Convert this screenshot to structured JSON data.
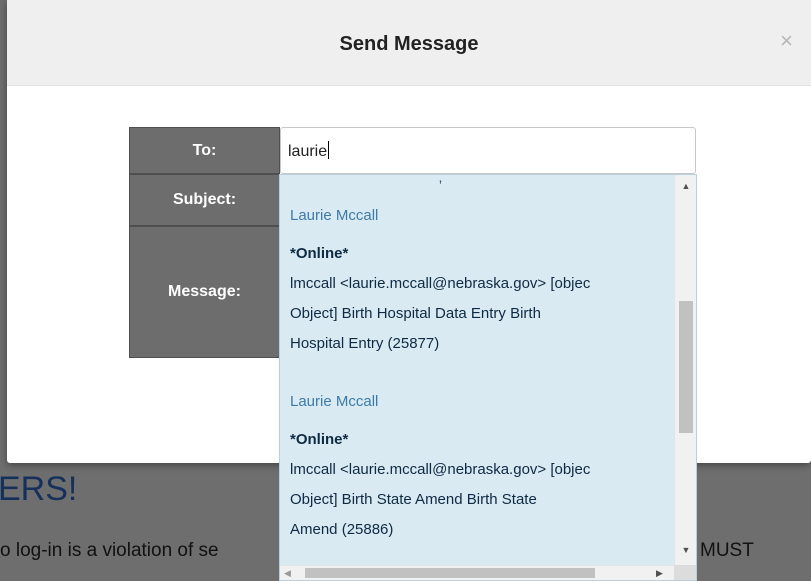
{
  "background": {
    "heading_fragment": "ERS!",
    "text_left_fragment": "o log-in is a violation of se",
    "text_right_fragment": "MUST"
  },
  "modal": {
    "title": "Send Message",
    "close_label": "×"
  },
  "form": {
    "to_label": "To:",
    "subject_label": "Subject:",
    "message_label": "Message:",
    "to_value": "laurie"
  },
  "dropdown": {
    "partial_text": "`    ,    ´",
    "items": [
      {
        "name": "Laurie Mccall",
        "status": "*Online*",
        "lines": [
          "lmccall <laurie.mccall@nebraska.gov> [objec",
          "Object] Birth Hospital Data Entry Birth",
          "Hospital Entry (25877)"
        ]
      },
      {
        "name": "Laurie Mccall",
        "status": "*Online*",
        "lines": [
          "lmccall <laurie.mccall@nebraska.gov> [objec",
          "Object] Birth State Amend Birth State",
          "Amend (25886)"
        ]
      }
    ]
  },
  "icons": {
    "scroll_up": "▲",
    "scroll_down": "▼",
    "scroll_left": "◀",
    "scroll_right": "▶"
  }
}
